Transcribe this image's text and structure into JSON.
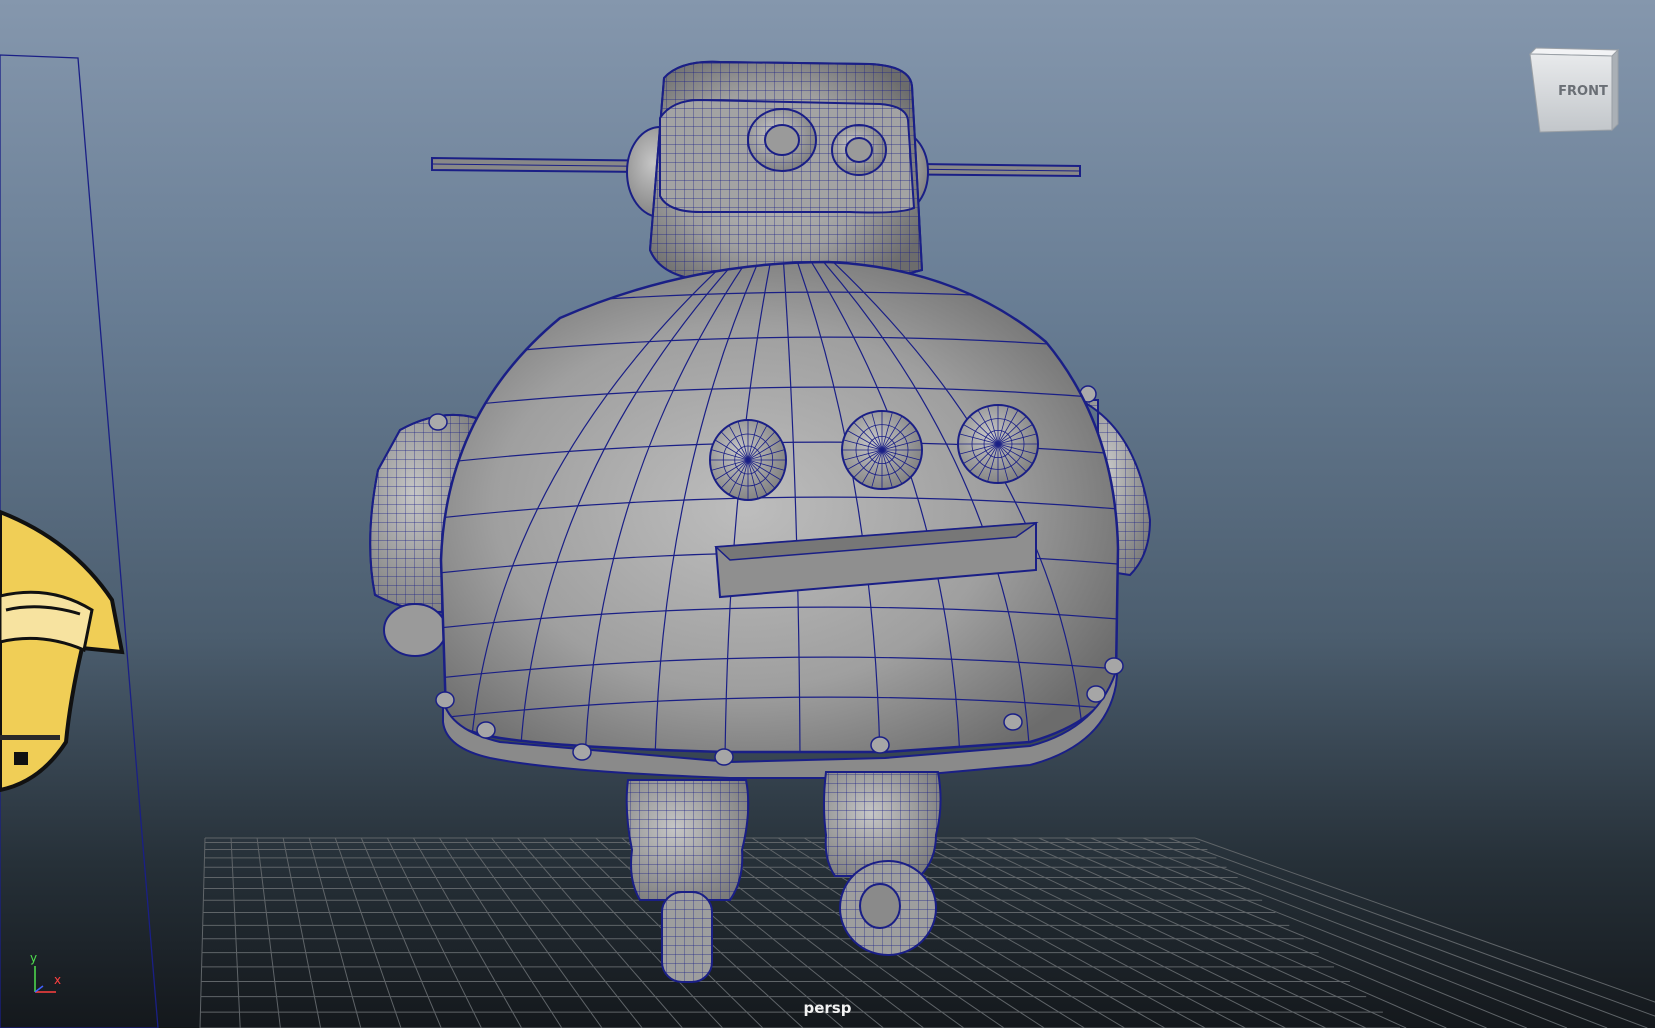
{
  "viewport": {
    "camera_label": "persp",
    "view_cube_label": "FRONT",
    "axis_labels": {
      "y": "y",
      "x": "x"
    }
  },
  "colors": {
    "wireframe": "#1a1f86",
    "mesh_shade": "#a8a8a8",
    "axis_x": "#ff4040",
    "axis_y": "#4fe04f",
    "axis_z": "#4060ff",
    "grid": "#5f6468",
    "image_plane_yellow": "#f0ce56"
  },
  "objects": [
    {
      "name": "robot-mesh",
      "type": "polygon-mesh"
    },
    {
      "name": "image-plane",
      "type": "reference-image"
    },
    {
      "name": "ground-grid",
      "type": "grid"
    }
  ]
}
